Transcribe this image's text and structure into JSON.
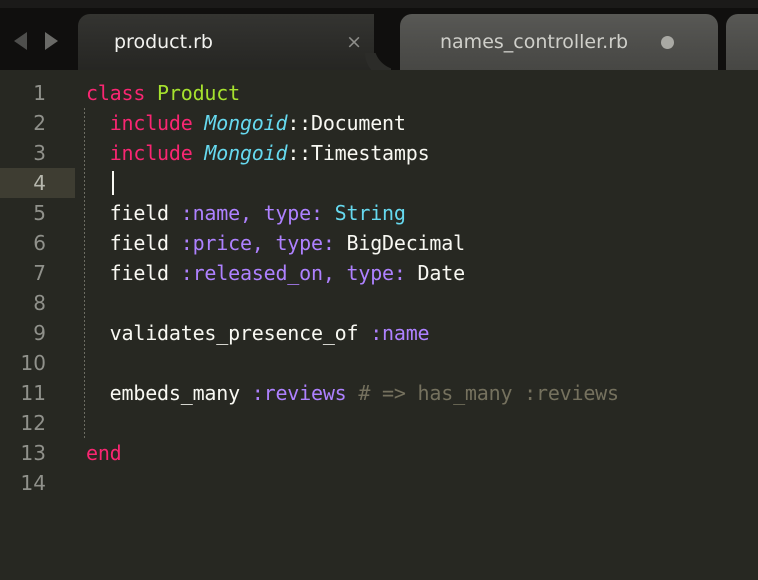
{
  "window": {
    "theme_name": "Monokai",
    "background": "#272822",
    "tabbar_background": "#100f0e"
  },
  "tabbar": {
    "nav_prev_icon": "arrow-left-icon",
    "nav_next_icon": "arrow-right-icon",
    "tabs": [
      {
        "label": "product.rb",
        "active": true,
        "close_icon": "×",
        "dirty": false
      },
      {
        "label": "names_controller.rb",
        "active": false,
        "close_icon": "",
        "dirty": true,
        "dirty_icon": "unsaved-dot-icon"
      },
      {
        "label": "",
        "active": false,
        "close_icon": "",
        "dirty": false
      }
    ]
  },
  "editor": {
    "language": "Ruby",
    "active_line": 4,
    "cursor": {
      "line": 4,
      "column": 2
    },
    "colors": {
      "keyword": "#f92672",
      "class_name": "#a6e22e",
      "constant": "#66d9ef",
      "plain": "#f8f8f2",
      "symbol": "#ae81ff",
      "comment": "#75715e",
      "line_number": "#90918b",
      "active_line_gutter": "#3e3d32"
    },
    "lines": [
      {
        "number": "1",
        "tokens": [
          {
            "text": "class ",
            "type": "keyword"
          },
          {
            "text": "Product",
            "type": "class_name"
          }
        ]
      },
      {
        "number": "2",
        "tokens": [
          {
            "text": "  ",
            "type": "plain"
          },
          {
            "text": "include ",
            "type": "keyword"
          },
          {
            "text": "Mongoid",
            "type": "constant"
          },
          {
            "text": "::Document",
            "type": "plain"
          }
        ]
      },
      {
        "number": "3",
        "tokens": [
          {
            "text": "  ",
            "type": "plain"
          },
          {
            "text": "include ",
            "type": "keyword"
          },
          {
            "text": "Mongoid",
            "type": "constant"
          },
          {
            "text": "::Timestamps",
            "type": "plain"
          }
        ]
      },
      {
        "number": "4",
        "tokens": []
      },
      {
        "number": "5",
        "tokens": [
          {
            "text": "  field ",
            "type": "plain"
          },
          {
            "text": ":name, type:",
            "type": "symbol"
          },
          {
            "text": " ",
            "type": "plain"
          },
          {
            "text": "String",
            "type": "constant_plain"
          }
        ]
      },
      {
        "number": "6",
        "tokens": [
          {
            "text": "  field ",
            "type": "plain"
          },
          {
            "text": ":price, type:",
            "type": "symbol"
          },
          {
            "text": " BigDecimal",
            "type": "plain"
          }
        ]
      },
      {
        "number": "7",
        "tokens": [
          {
            "text": "  field ",
            "type": "plain"
          },
          {
            "text": ":released_on, type:",
            "type": "symbol"
          },
          {
            "text": " Date",
            "type": "plain"
          }
        ]
      },
      {
        "number": "8",
        "tokens": []
      },
      {
        "number": "9",
        "tokens": [
          {
            "text": "  validates_presence_of ",
            "type": "plain"
          },
          {
            "text": ":name",
            "type": "symbol"
          }
        ]
      },
      {
        "number": "10",
        "tokens": []
      },
      {
        "number": "11",
        "tokens": [
          {
            "text": "  embeds_many ",
            "type": "plain"
          },
          {
            "text": ":reviews",
            "type": "symbol"
          },
          {
            "text": " # => has_many :reviews",
            "type": "comment"
          }
        ]
      },
      {
        "number": "12",
        "tokens": []
      },
      {
        "number": "13",
        "tokens": [
          {
            "text": "end",
            "type": "keyword"
          }
        ]
      },
      {
        "number": "14",
        "tokens": []
      }
    ]
  }
}
